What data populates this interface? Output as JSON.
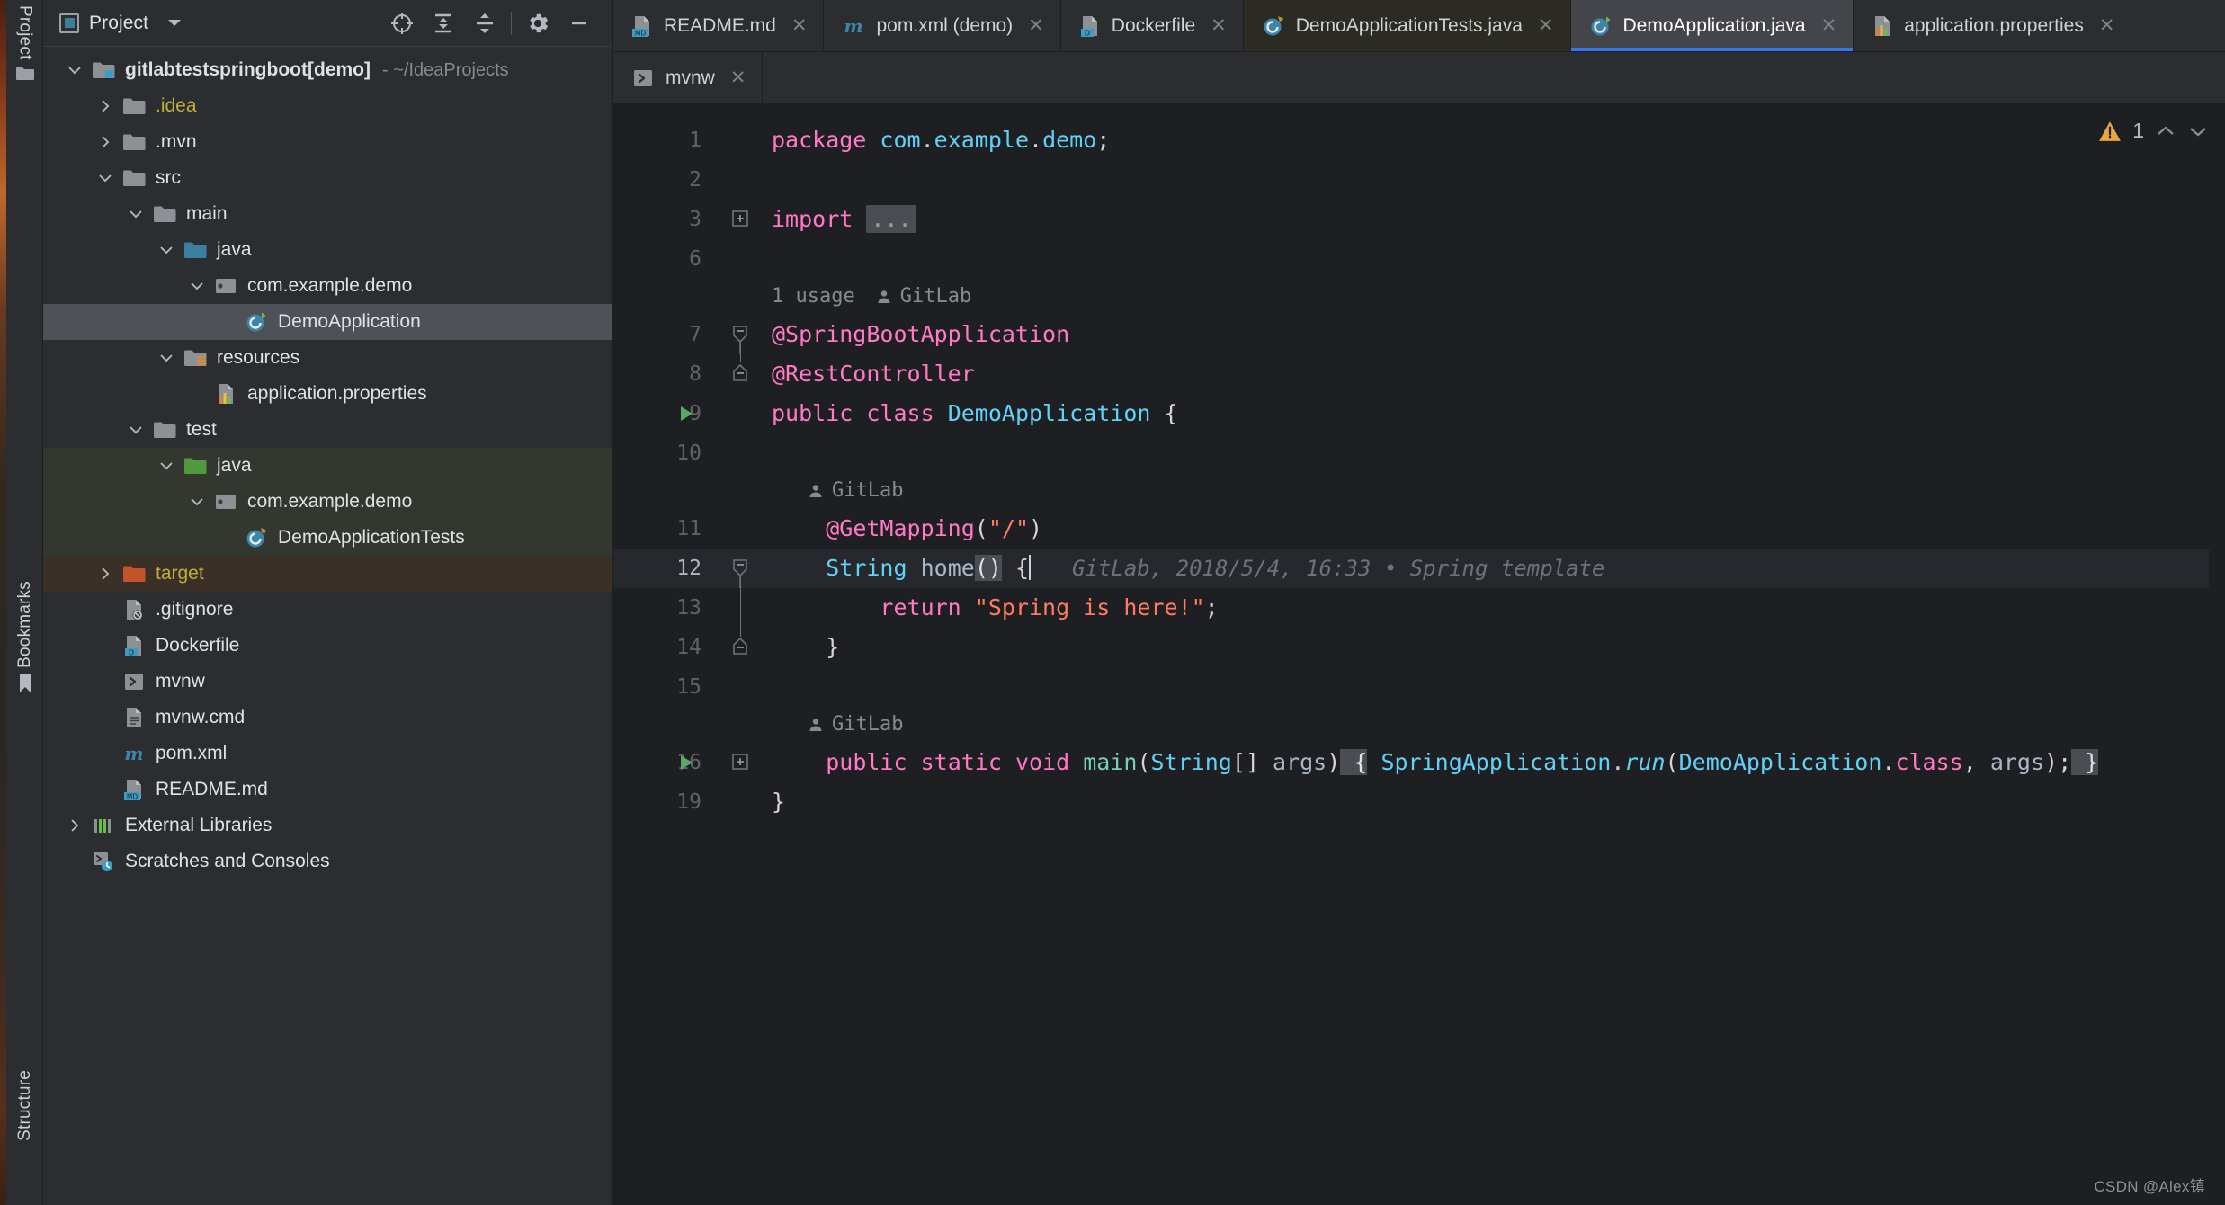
{
  "rail": {
    "top_label": "Project",
    "bookmarks_label": "Bookmarks",
    "structure_label": "Structure"
  },
  "project_panel": {
    "title": "Project",
    "tools": [
      {
        "name": "locate-icon",
        "tooltip": "Select Opened File"
      },
      {
        "name": "expand-all-icon",
        "tooltip": "Expand All"
      },
      {
        "name": "collapse-all-icon",
        "tooltip": "Collapse All"
      },
      {
        "name": "settings-gear-icon",
        "tooltip": "Options"
      },
      {
        "name": "hide-icon",
        "tooltip": "Hide"
      }
    ],
    "tree": [
      {
        "label": "gitlabtestspringboot",
        "module": " [demo]",
        "path": "- ~/IdeaProjects",
        "depth": 0,
        "twist": "down",
        "icon": "module-folder",
        "style": "bold"
      },
      {
        "label": ".idea",
        "depth": 1,
        "twist": "right",
        "icon": "folder",
        "style": "yellow"
      },
      {
        "label": ".mvn",
        "depth": 1,
        "twist": "right",
        "icon": "folder"
      },
      {
        "label": "src",
        "depth": 1,
        "twist": "down",
        "icon": "folder"
      },
      {
        "label": "main",
        "depth": 2,
        "twist": "down",
        "icon": "folder"
      },
      {
        "label": "java",
        "depth": 3,
        "twist": "down",
        "icon": "folder-source-blue"
      },
      {
        "label": "com.example.demo",
        "depth": 4,
        "twist": "down",
        "icon": "package"
      },
      {
        "label": "DemoApplication",
        "depth": 5,
        "twist": "none",
        "icon": "java-class-spring",
        "selected": true
      },
      {
        "label": "resources",
        "depth": 3,
        "twist": "down",
        "icon": "folder-resources"
      },
      {
        "label": "application.properties",
        "depth": 4,
        "twist": "none",
        "icon": "properties-file"
      },
      {
        "label": "test",
        "depth": 2,
        "twist": "down",
        "icon": "folder"
      },
      {
        "label": "java",
        "depth": 3,
        "twist": "down",
        "icon": "folder-test-green",
        "testbg": true
      },
      {
        "label": "com.example.demo",
        "depth": 4,
        "twist": "down",
        "icon": "package",
        "testbg": true
      },
      {
        "label": "DemoApplicationTests",
        "depth": 5,
        "twist": "none",
        "icon": "java-class-test",
        "testbg": true
      },
      {
        "label": "target",
        "depth": 1,
        "twist": "right",
        "icon": "folder-excluded",
        "style": "yellow",
        "targetbg": true
      },
      {
        "label": ".gitignore",
        "depth": 1,
        "twist": "none",
        "icon": "gitignore-file"
      },
      {
        "label": "Dockerfile",
        "depth": 1,
        "twist": "none",
        "icon": "docker-file"
      },
      {
        "label": "mvnw",
        "depth": 1,
        "twist": "none",
        "icon": "shell-script-file"
      },
      {
        "label": "mvnw.cmd",
        "depth": 1,
        "twist": "none",
        "icon": "text-file"
      },
      {
        "label": "pom.xml",
        "depth": 1,
        "twist": "none",
        "icon": "maven-file"
      },
      {
        "label": "README.md",
        "depth": 1,
        "twist": "none",
        "icon": "markdown-file"
      },
      {
        "label": "External Libraries",
        "depth": 0,
        "twist": "right",
        "icon": "libraries-icon"
      },
      {
        "label": "Scratches and Consoles",
        "depth": 0,
        "twist": "none",
        "icon": "scratches-icon"
      }
    ]
  },
  "editor_tabs_row1": [
    {
      "label": "README.md",
      "icon": "markdown-file",
      "active": false,
      "modified": false
    },
    {
      "label": "pom.xml (demo)",
      "icon": "maven-file",
      "active": false,
      "modified": false
    },
    {
      "label": "Dockerfile",
      "icon": "docker-file",
      "active": false,
      "modified": false
    },
    {
      "label": "DemoApplicationTests.java",
      "icon": "java-class-test",
      "active": false,
      "modified": true
    },
    {
      "label": "DemoApplication.java",
      "icon": "java-class-spring",
      "active": true,
      "modified": false
    },
    {
      "label": "application.properties",
      "icon": "properties-file",
      "active": false,
      "modified": false
    }
  ],
  "editor_tabs_row2": [
    {
      "label": "mvnw",
      "icon": "shell-script-file",
      "active": false,
      "modified": false
    }
  ],
  "inspection_widget": {
    "warning_count": "1",
    "icon": "warning-triangle-icon",
    "up_chevron": "⌃",
    "down_chevron": "⌄"
  },
  "code": {
    "line_numbers": [
      "1",
      "2",
      "3",
      "6",
      "7",
      "8",
      "9",
      "10",
      "11",
      "12",
      "13",
      "14",
      "15",
      "16",
      "19"
    ],
    "current_line": "12",
    "lines": [
      {
        "n": "1",
        "tokens": [
          {
            "t": "package",
            "c": "kw"
          },
          {
            "t": " ",
            "c": "plain"
          },
          {
            "t": "com",
            "c": "type"
          },
          {
            "t": ".",
            "c": "plain"
          },
          {
            "t": "example",
            "c": "type"
          },
          {
            "t": ".",
            "c": "plain"
          },
          {
            "t": "demo",
            "c": "type"
          },
          {
            "t": ";",
            "c": "plain"
          }
        ]
      },
      {
        "n": "2",
        "tokens": []
      },
      {
        "n": "3",
        "tokens": [
          {
            "t": "import",
            "c": "kw"
          },
          {
            "t": " ",
            "c": "plain"
          },
          {
            "t": "...",
            "c": "folded"
          }
        ],
        "fold": "plus"
      },
      {
        "n": "6",
        "tokens": []
      },
      {
        "n": "7",
        "tokens": [
          {
            "t": "@SpringBootApplication",
            "c": "anno"
          }
        ],
        "fold": "minus-top",
        "hint": {
          "usages": "1 usage",
          "author": "GitLab"
        }
      },
      {
        "n": "8",
        "tokens": [
          {
            "t": "@RestController",
            "c": "anno"
          }
        ],
        "fold": "minus-end"
      },
      {
        "n": "9",
        "tokens": [
          {
            "t": "public",
            "c": "kw"
          },
          {
            "t": " ",
            "c": "plain"
          },
          {
            "t": "class",
            "c": "kw"
          },
          {
            "t": " ",
            "c": "plain"
          },
          {
            "t": "DemoApplication",
            "c": "cls"
          },
          {
            "t": " {",
            "c": "plain"
          }
        ],
        "run": true
      },
      {
        "n": "10",
        "tokens": []
      },
      {
        "n": "11",
        "tokens": [
          {
            "t": "    ",
            "c": "plain"
          },
          {
            "t": "@GetMapping",
            "c": "anno"
          },
          {
            "t": "(",
            "c": "plain"
          },
          {
            "t": "\"/\"",
            "c": "str"
          },
          {
            "t": ")",
            "c": "plain"
          }
        ],
        "hint": {
          "author": "GitLab"
        }
      },
      {
        "n": "12",
        "tokens": [
          {
            "t": "    ",
            "c": "plain"
          },
          {
            "t": "String",
            "c": "type"
          },
          {
            "t": " ",
            "c": "plain"
          },
          {
            "t": "home",
            "c": "ident"
          },
          {
            "t": "()",
            "c": "brace-hl"
          },
          {
            "t": " {",
            "c": "plain"
          }
        ],
        "fold": "minus-top",
        "highlighted": true,
        "blame": "GitLab, 2018/5/4, 16:33 • Spring template"
      },
      {
        "n": "13",
        "tokens": [
          {
            "t": "        ",
            "c": "plain"
          },
          {
            "t": "return",
            "c": "kw"
          },
          {
            "t": " ",
            "c": "plain"
          },
          {
            "t": "\"Spring is here!\"",
            "c": "str"
          },
          {
            "t": ";",
            "c": "plain"
          }
        ]
      },
      {
        "n": "14",
        "tokens": [
          {
            "t": "    }",
            "c": "plain"
          }
        ],
        "fold": "minus-bottom"
      },
      {
        "n": "15",
        "tokens": []
      },
      {
        "n": "16",
        "tokens": [
          {
            "t": "    ",
            "c": "plain"
          },
          {
            "t": "public",
            "c": "kw"
          },
          {
            "t": " ",
            "c": "plain"
          },
          {
            "t": "static",
            "c": "kw"
          },
          {
            "t": " ",
            "c": "plain"
          },
          {
            "t": "void",
            "c": "kw"
          },
          {
            "t": " ",
            "c": "plain"
          },
          {
            "t": "main",
            "c": "method"
          },
          {
            "t": "(",
            "c": "plain"
          },
          {
            "t": "String",
            "c": "type"
          },
          {
            "t": "[] ",
            "c": "plain"
          },
          {
            "t": "args",
            "c": "ident"
          },
          {
            "t": ")",
            "c": "plain"
          },
          {
            "t": " {",
            "c": "brace-hl"
          },
          {
            "t": " ",
            "c": "plain"
          },
          {
            "t": "SpringApplication",
            "c": "type"
          },
          {
            "t": ".",
            "c": "plain"
          },
          {
            "t": "run",
            "c": "type ital"
          },
          {
            "t": "(",
            "c": "plain"
          },
          {
            "t": "DemoApplication",
            "c": "type"
          },
          {
            "t": ".",
            "c": "plain"
          },
          {
            "t": "class",
            "c": "kw"
          },
          {
            "t": ", ",
            "c": "plain"
          },
          {
            "t": "args",
            "c": "ident"
          },
          {
            "t": ");",
            "c": "plain"
          },
          {
            "t": " }",
            "c": "brace-hl"
          }
        ],
        "run": true,
        "fold": "plus",
        "hint": {
          "author": "GitLab"
        }
      },
      {
        "n": "19",
        "tokens": [
          {
            "t": "}",
            "c": "plain"
          }
        ]
      }
    ]
  },
  "watermark": "CSDN @Alex镇",
  "colors": {
    "bg_panel": "#2b2d30",
    "bg_editor": "#1e1f22",
    "accent_blue": "#3574f0",
    "selection": "#4e5157",
    "keyword_pink": "#ff79c6",
    "type_cyan": "#61d2f5",
    "string_orange": "#ff7b63",
    "method_green": "#78d0b2",
    "warning_yellow": "#e5a83c",
    "test_bg": "#33372f",
    "target_bg": "#3a3027"
  }
}
